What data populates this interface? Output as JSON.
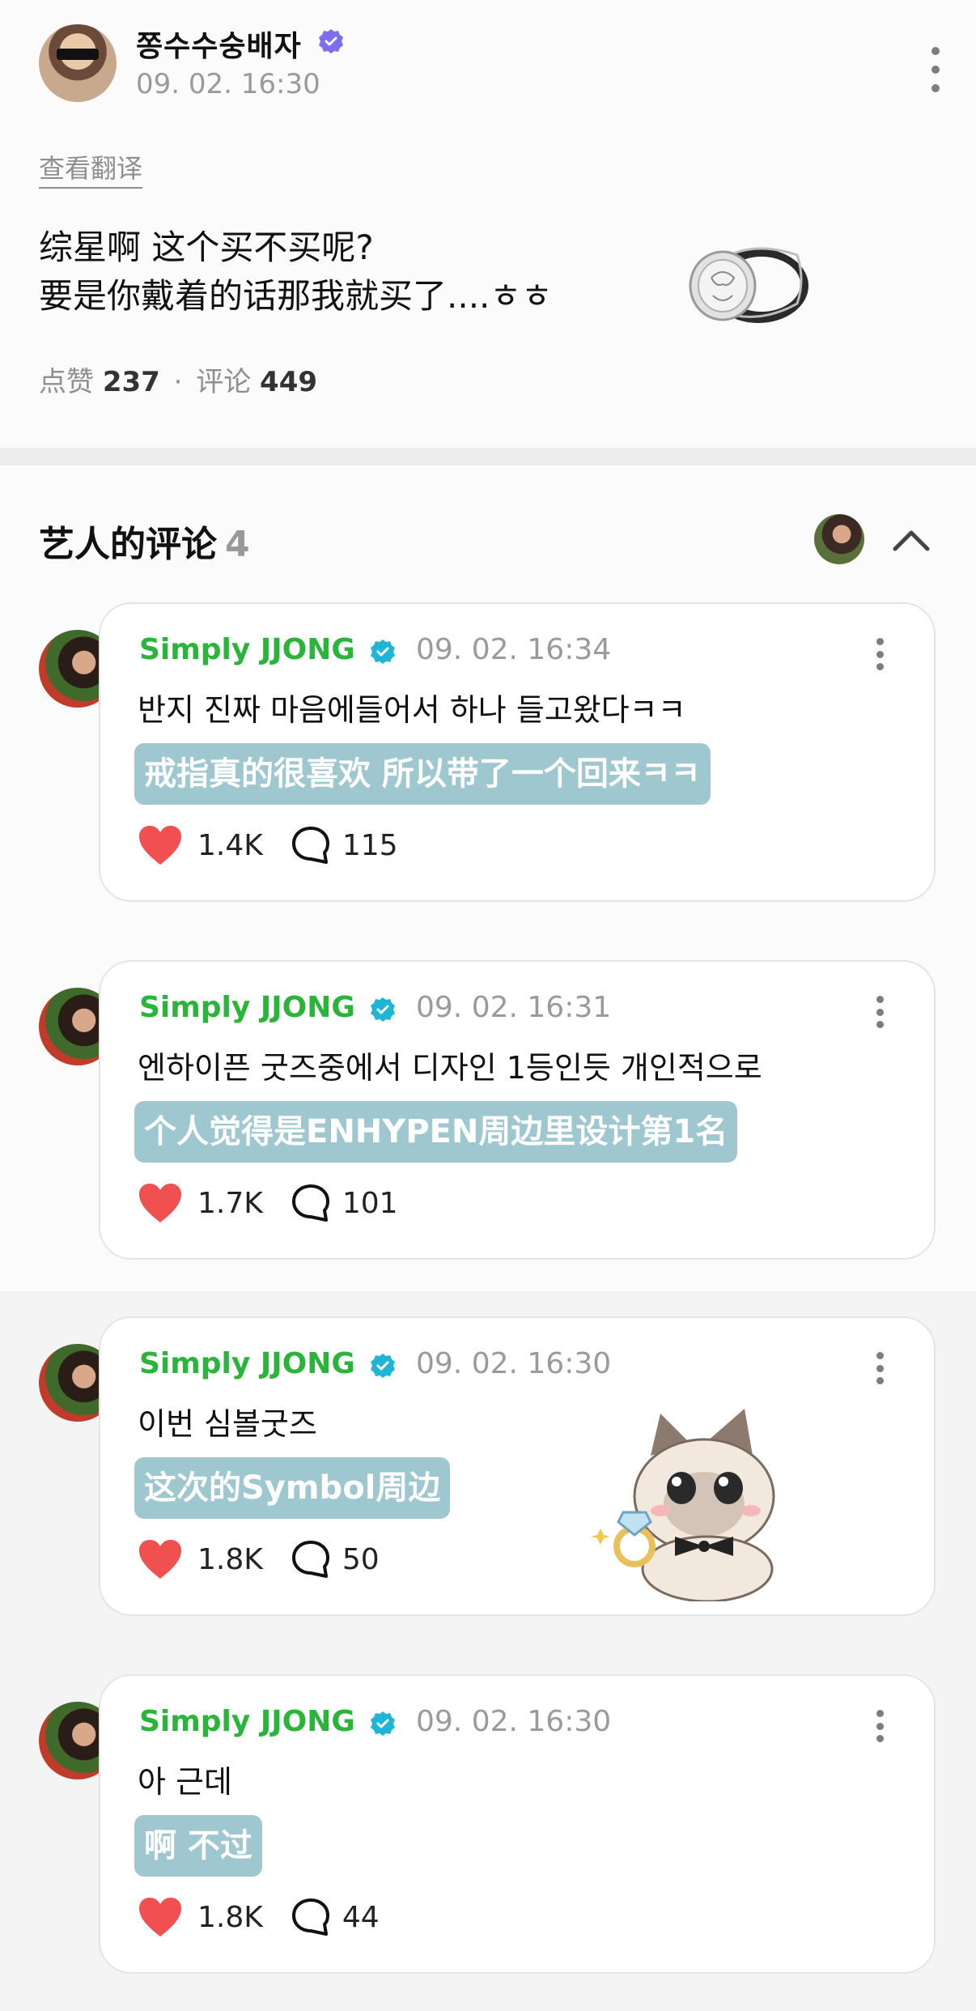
{
  "post": {
    "author": "쫑수수숭배자",
    "time": "09. 02. 16:30",
    "translate_link": "查看翻译",
    "body_lines": [
      "综星啊 这个买不买呢?",
      "要是你戴着的话那我就买了....ㅎㅎ"
    ],
    "likes_label": "点赞",
    "likes": "237",
    "separator": "·",
    "comments_label": "评论",
    "comments": "449"
  },
  "section": {
    "title": "艺人的评论",
    "count": "4"
  },
  "comments": [
    {
      "name": "Simply JJONG",
      "time": "09. 02. 16:34",
      "text": "반지 진짜 마음에들어서 하나 들고왔다ㅋㅋ",
      "translation": "戒指真的很喜欢 所以带了一个回来ㅋㅋ",
      "likes": "1.4K",
      "replies": "115"
    },
    {
      "name": "Simply JJONG",
      "time": "09. 02. 16:31",
      "text": "엔하이픈 굿즈중에서 디자인 1등인듯 개인적으로",
      "translation": "个人觉得是ENHYPEN周边里设计第1名",
      "likes": "1.7K",
      "replies": "101"
    },
    {
      "name": "Simply JJONG",
      "time": "09. 02. 16:30",
      "text": "이번 심볼굿즈",
      "translation": "这次的Symbol周边",
      "likes": "1.8K",
      "replies": "50"
    },
    {
      "name": "Simply JJONG",
      "time": "09. 02. 16:30",
      "text": "아 근데",
      "translation": "啊 不过",
      "likes": "1.8K",
      "replies": "44"
    }
  ],
  "colors": {
    "artist_name": "#2ab53a",
    "verified_badge": "#1fb6d6",
    "translation_bg": "#9ec7cf",
    "heart": "#f0504f",
    "author_badge": "#7b6ef0"
  },
  "icons": [
    "verified-icon",
    "more-icon",
    "chevron-up-icon",
    "heart-icon",
    "comment-bubble-icon"
  ]
}
